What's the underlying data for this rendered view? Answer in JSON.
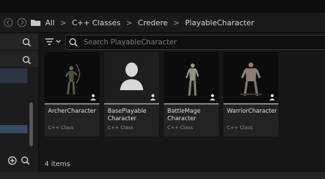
{
  "breadcrumb": {
    "items": [
      "All",
      "C++ Classes",
      "Credere",
      "PlayableCharacter"
    ]
  },
  "search": {
    "placeholder": "Search PlayableCharacter"
  },
  "assets": [
    {
      "name": "ArcherCharacter",
      "type": "C++ Class",
      "thumbnail": "archer-figure"
    },
    {
      "name": "BasePlayable Character",
      "type": "C++ Class",
      "thumbnail": "default-avatar"
    },
    {
      "name": "BattleMage Character",
      "type": "C++ Class",
      "thumbnail": "battlemage-figure"
    },
    {
      "name": "WarriorCharacter",
      "type": "C++ Class",
      "thumbnail": "warrior-figure"
    }
  ],
  "status": {
    "item_count": "4 items"
  },
  "icons": {
    "back": "back-arrow-icon",
    "forward": "forward-arrow-icon",
    "folder": "folder-icon",
    "filter": "filter-icon",
    "search": "search-icon",
    "add": "add-icon",
    "class_badge": "person-icon"
  },
  "colors": {
    "selection": "#3a4b62",
    "background": "#151515",
    "tile": "#232323"
  }
}
